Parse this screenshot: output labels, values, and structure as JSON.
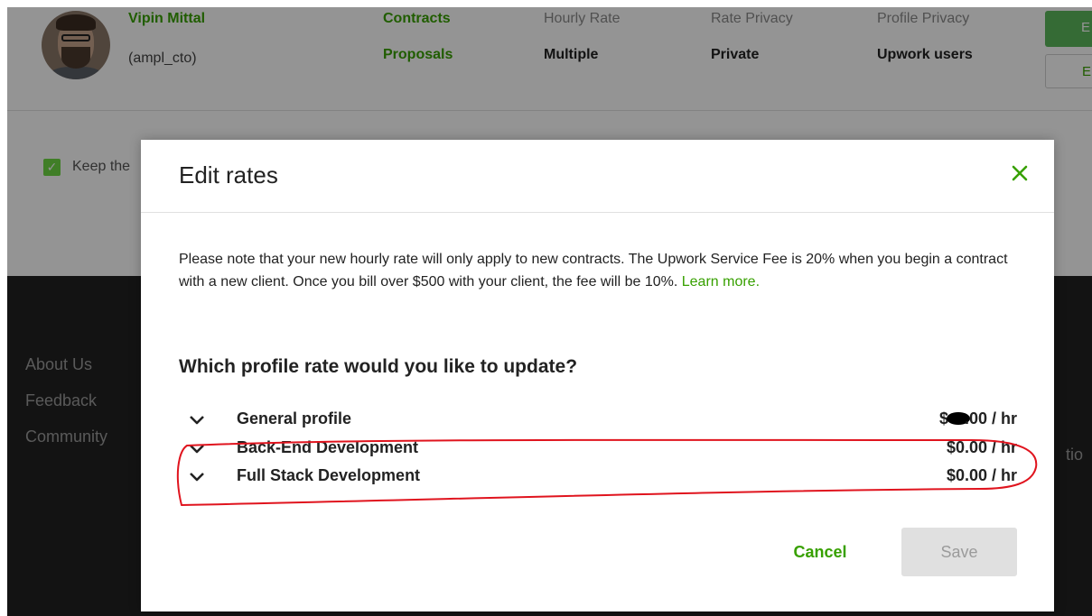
{
  "profile": {
    "name": "Vipin Mittal",
    "handle": "(ampl_cto)",
    "links": [
      "Contracts",
      "Proposals"
    ],
    "stats": [
      {
        "heading": "Hourly Rate",
        "value": "Multiple"
      },
      {
        "heading": "Rate Privacy",
        "value": "Private"
      },
      {
        "heading": "Profile Privacy",
        "value": "Upwork users"
      }
    ],
    "primary_button": "E",
    "secondary_button": "E"
  },
  "keep_option": {
    "label": "Keep the",
    "checked": true
  },
  "footer": {
    "links": [
      "About Us",
      "Feedback",
      "Community"
    ],
    "right_text": "tio"
  },
  "modal": {
    "title": "Edit rates",
    "close_icon": "close-icon",
    "notice_text": "Please note that your new hourly rate will only apply to new contracts. The Upwork Service Fee is 20% when you begin a contract with a new client. Once you bill over $500 with your client, the fee will be 10%.",
    "learn_more": "Learn more.",
    "question": "Which profile rate would you like to update?",
    "rates": [
      {
        "label": "General profile",
        "value_prefix": "$",
        "value_suffix": ".00 / hr",
        "redacted": true
      },
      {
        "label": "Back-End Development",
        "value": "$0.00 / hr"
      },
      {
        "label": "Full Stack Development",
        "value": "$0.00 / hr"
      }
    ],
    "cancel_label": "Cancel",
    "save_label": "Save"
  },
  "colors": {
    "accent_green": "#37a000",
    "annotation_red": "#e0141e",
    "overlay": "rgba(0,0,0,0.42)"
  }
}
